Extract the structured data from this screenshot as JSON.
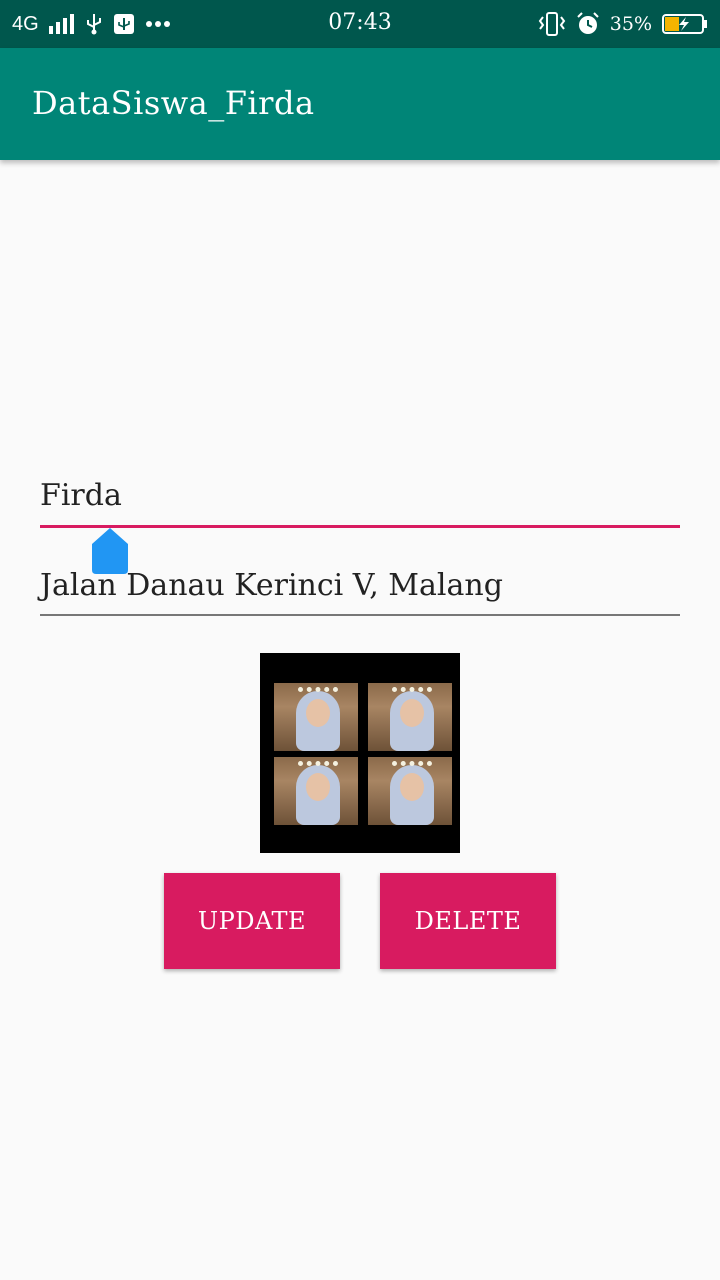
{
  "status_bar": {
    "network": "4G",
    "time": "07:43",
    "battery_percent": "35%",
    "icons": [
      "signal-icon",
      "usb-icon",
      "usb-debug-icon",
      "more-icon",
      "vibrate-icon",
      "alarm-icon",
      "battery-charging-icon"
    ]
  },
  "app_bar": {
    "title": "DataSiswa_Firda"
  },
  "form": {
    "name_value": "Firda",
    "address_value": "Jalan Danau Kerinci V, Malang"
  },
  "buttons": {
    "update_label": "UPDATE",
    "delete_label": "DELETE"
  },
  "colors": {
    "status_bar": "#00574d",
    "primary": "#008577",
    "accent": "#d81b60",
    "cursor_handle": "#2196f3"
  }
}
